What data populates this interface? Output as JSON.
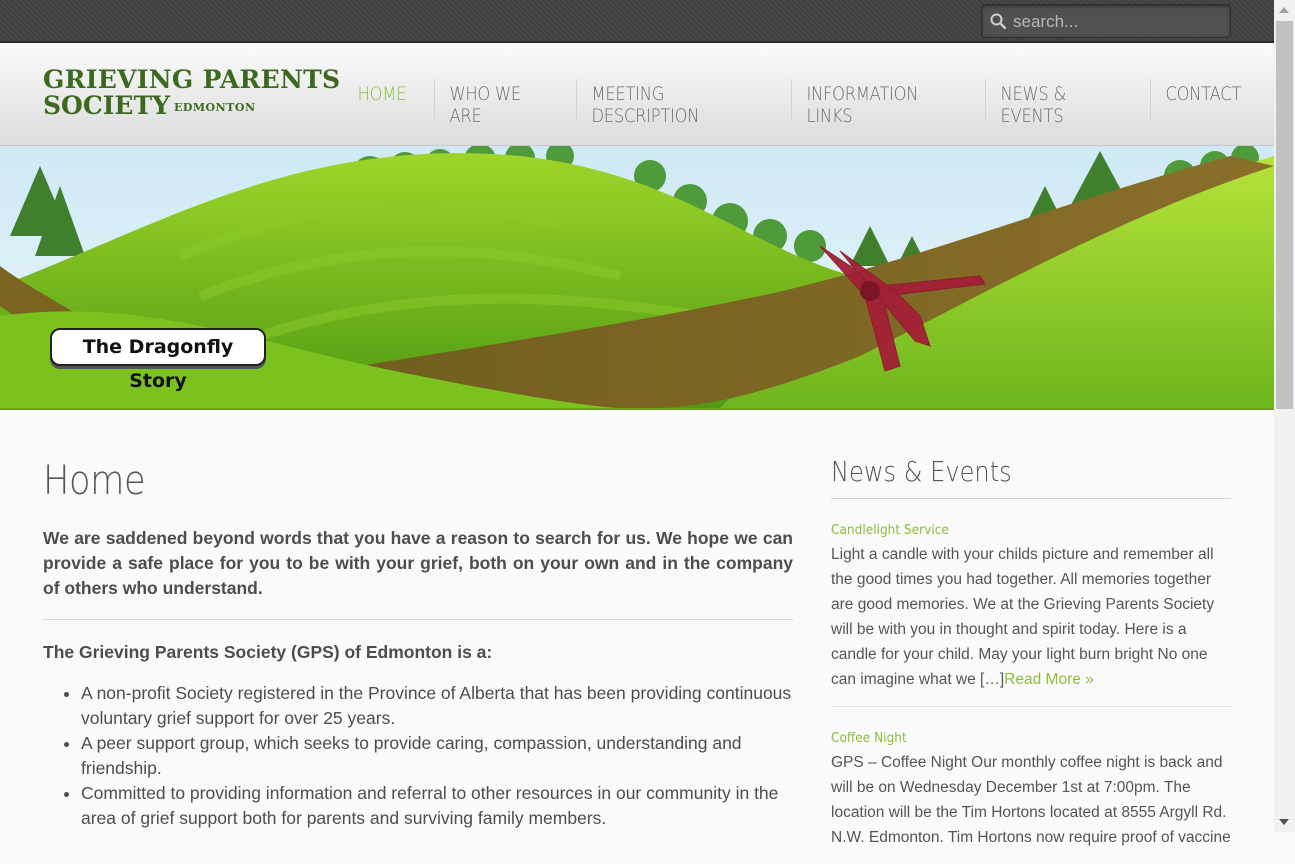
{
  "search": {
    "placeholder": "search..."
  },
  "logo": {
    "line1": "GRIEVING PARENTS",
    "line2": "SOCIETY",
    "city": "EDMONTON"
  },
  "nav": [
    {
      "label": "HOME",
      "active": true
    },
    {
      "label": "WHO WE ARE"
    },
    {
      "label": "MEETING DESCRIPTION"
    },
    {
      "label": "INFORMATION LINKS"
    },
    {
      "label": "NEWS & EVENTS"
    },
    {
      "label": "CONTACT"
    }
  ],
  "banner": {
    "badge": "The Dragonfly Story"
  },
  "main": {
    "title": "Home",
    "intro": "We are saddened beyond words that you have a reason to search for us.  We hope we can provide a safe place for you to be with your grief, both on your own and in the company of others who understand.",
    "lead": "The Grieving Parents Society (GPS) of Edmonton is a:",
    "bullets": [
      "A non-profit Society registered in the Province of Alberta that has been providing continuous voluntary grief support for over 25 years.",
      "A peer support group, which seeks to provide caring, compassion, understanding and friendship.",
      "Committed to providing information and referral to other resources in our community in the area of grief support both for parents and surviving family members."
    ]
  },
  "sidebar": {
    "title": "News & Events",
    "items": [
      {
        "title": "Candlelight Service",
        "body": "Light a candle with your childs picture and remember all the good times you had together. All memories together are good memories. We at the Grieving Parents Society will be with you in thought and spirit today. Here is a candle for your child. May your light burn bright No one can imagine what we […]",
        "more": "Read More »"
      },
      {
        "title": "Coffee Night",
        "body": "GPS – Coffee Night Our monthly coffee night is back and will be on Wednesday December 1st at 7:00pm. The location will be the Tim Hortons located at 8555 Argyll Rd. N.W. Edmonton. Tim Hortons now require proof of vaccine",
        "more": ""
      }
    ]
  },
  "colors": {
    "accent": "#8dbd3a",
    "logo": "#3b6a1e",
    "topbar": "#444444"
  }
}
